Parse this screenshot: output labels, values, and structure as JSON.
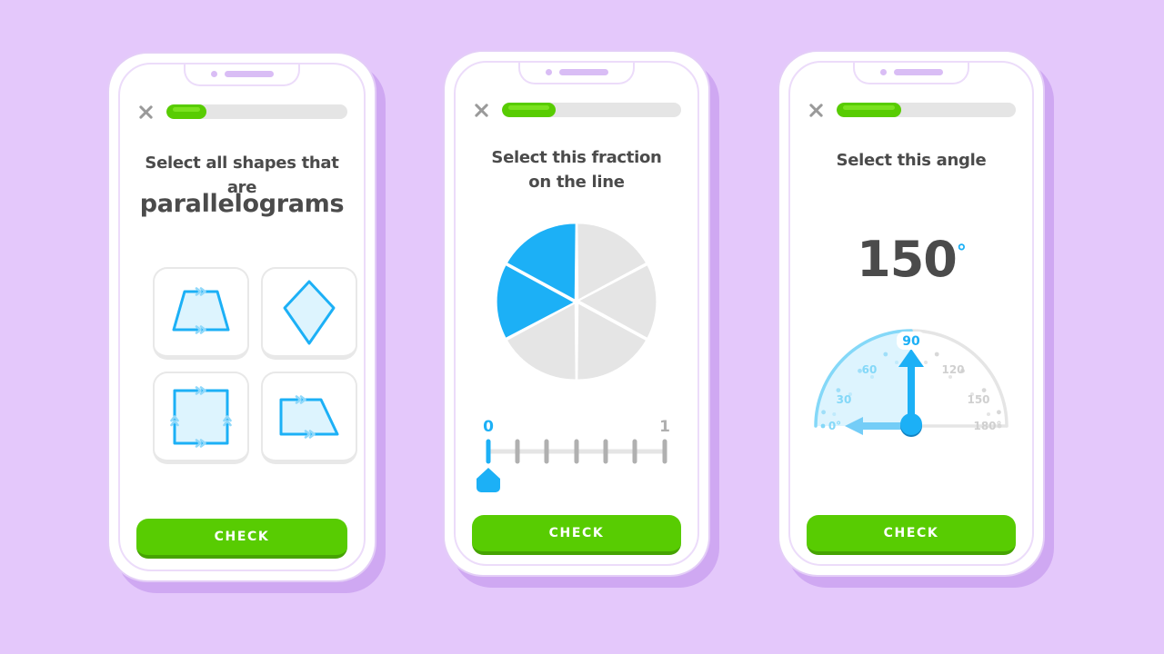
{
  "background_color": "#e4c8fb",
  "theme": {
    "green": "#58cc02",
    "green_dark": "#46a302",
    "blue": "#1cb0f6",
    "blue_light": "#ddf4fe",
    "text_dark": "#4b4b4b",
    "gray_track": "#e5e5e5",
    "gray_slice": "#e5e5e5",
    "phone_outline": "#e3cdf7",
    "phone_shadow": "#cfa8f2"
  },
  "phones": [
    {
      "id": "shapes",
      "topbar": {
        "close_icon": "close-x-icon",
        "progress_percent": 22
      },
      "prompt_line_1": "Select all shapes that are",
      "prompt_line_2": "parallelograms",
      "shapes": [
        {
          "name": "trapezoid-isosceles",
          "marks": "double-chevron-top-bottom"
        },
        {
          "name": "kite",
          "marks": "none"
        },
        {
          "name": "square",
          "marks": "chevrons-all-sides"
        },
        {
          "name": "trapezoid-right",
          "marks": "double-chevron-top-bottom"
        }
      ],
      "check_label": "CHECK"
    },
    {
      "id": "fraction",
      "topbar": {
        "close_icon": "close-x-icon",
        "progress_percent": 30
      },
      "prompt_line_1": "Select this fraction",
      "prompt_line_2": "on the line",
      "check_label": "CHECK",
      "numberline": {
        "start_label": "0",
        "end_label": "1",
        "segments": 6,
        "marker_position": 0
      }
    },
    {
      "id": "angle",
      "topbar": {
        "close_icon": "close-x-icon",
        "progress_percent": 36
      },
      "prompt_line_1": "Select this angle",
      "angle_value": "150",
      "degree_symbol": "°",
      "protractor": {
        "labels": [
          "0°",
          "30",
          "60",
          "90",
          "120",
          "150",
          "180°"
        ],
        "active_label": "90",
        "selected_angle": 90,
        "highlight_range": [
          0,
          90
        ]
      },
      "check_label": "CHECK"
    }
  ],
  "chart_data": {
    "type": "pie",
    "title": "Select this fraction on the line",
    "categories": [
      "filled",
      "filled",
      "empty",
      "empty",
      "empty",
      "empty"
    ],
    "values": [
      1,
      1,
      1,
      1,
      1,
      1
    ],
    "slices_total": 6,
    "slices_filled": 2,
    "fraction": "2/6",
    "colors": [
      "#1cb0f6",
      "#1cb0f6",
      "#e5e5e5",
      "#e5e5e5",
      "#e5e5e5",
      "#e5e5e5"
    ],
    "legend": "none",
    "grid": false
  }
}
